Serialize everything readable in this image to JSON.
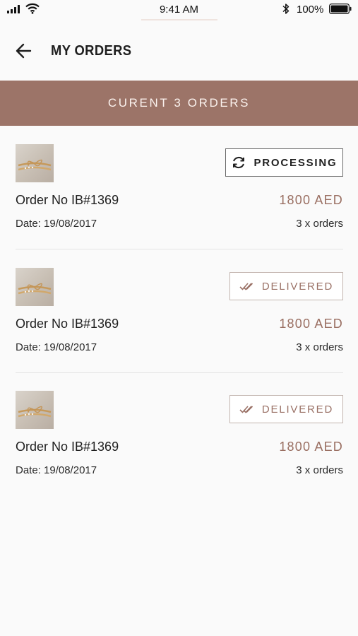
{
  "status_bar": {
    "time": "9:41 AM",
    "battery": "100%"
  },
  "header": {
    "title": "MY ORDERS",
    "back_icon": "arrow-left-icon"
  },
  "banner": {
    "text": "CURENT 3 ORDERS"
  },
  "orders": [
    {
      "status": "PROCESSING",
      "status_icon": "refresh-icon",
      "order_no": "Order No IB#1369",
      "price": "1800 AED",
      "date": "Date: 19/08/2017",
      "qty": "3 x orders"
    },
    {
      "status": "DELIVERED",
      "status_icon": "double-check-icon",
      "order_no": "Order No IB#1369",
      "price": "1800 AED",
      "date": "Date: 19/08/2017",
      "qty": "3 x orders"
    },
    {
      "status": "DELIVERED",
      "status_icon": "double-check-icon",
      "order_no": "Order No IB#1369",
      "price": "1800 AED",
      "date": "Date: 19/08/2017",
      "qty": "3 x orders"
    }
  ],
  "colors": {
    "accent": "#9c7468",
    "price": "#9a6f62",
    "background": "#fafafa"
  }
}
